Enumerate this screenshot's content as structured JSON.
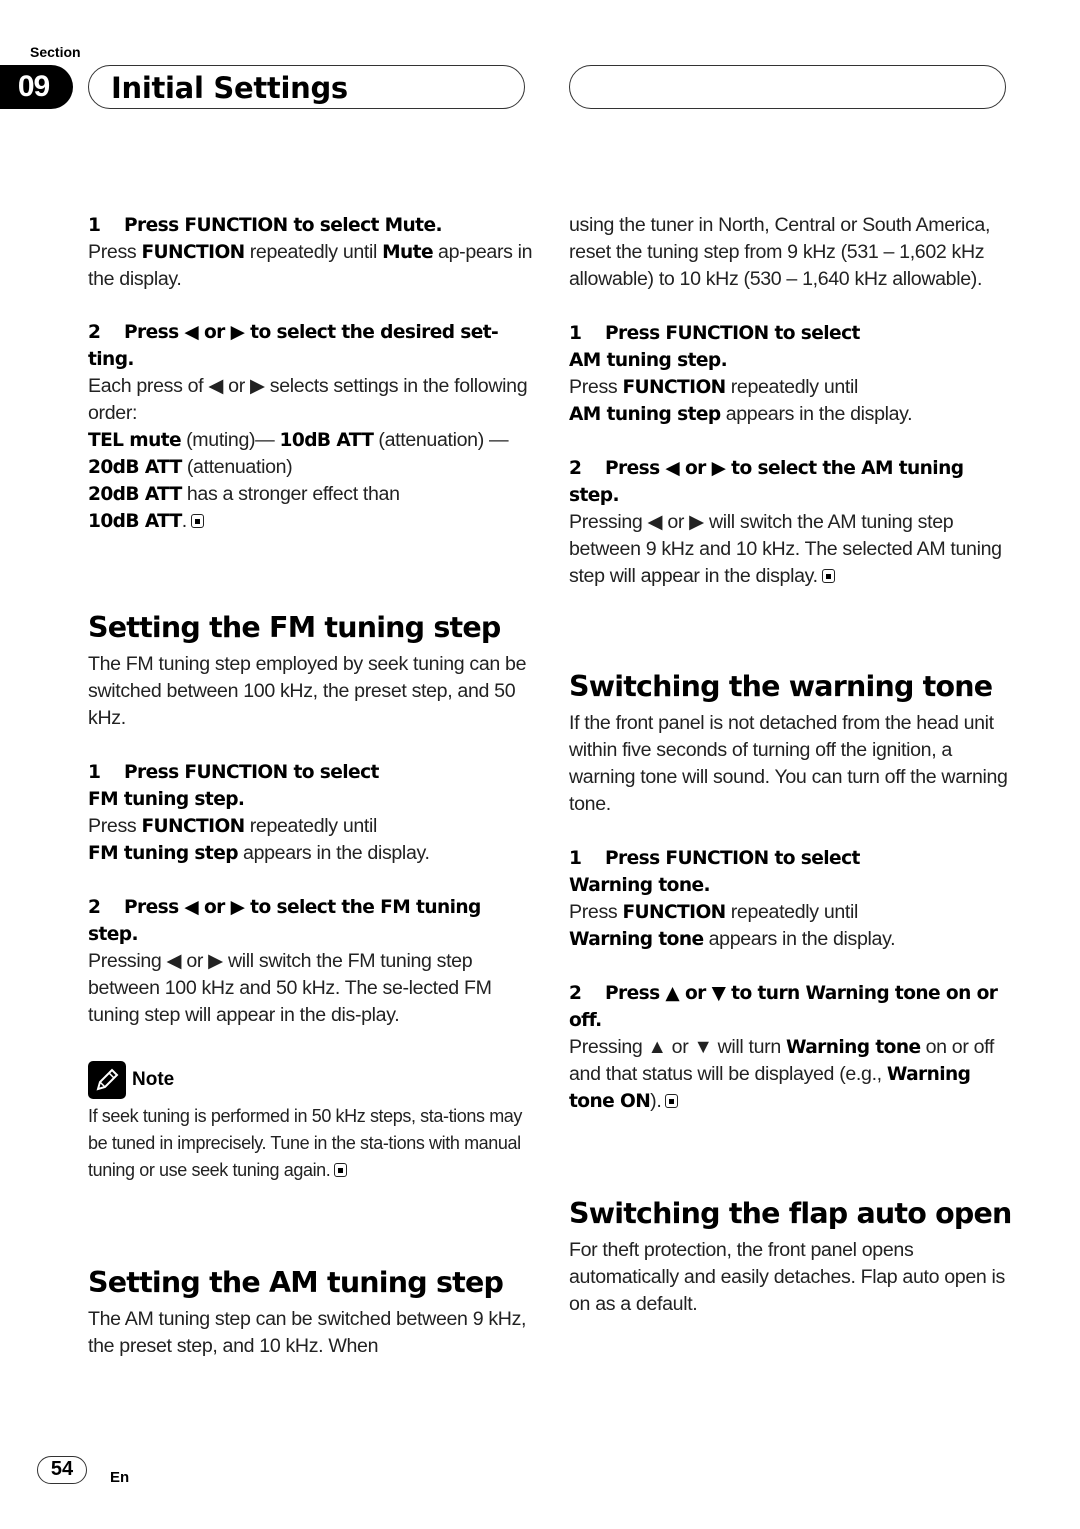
{
  "header": {
    "section_label": "Section",
    "section_number": "09",
    "title": "Initial Settings"
  },
  "left": {
    "mute_step1": {
      "num": "1",
      "heading": "Press FUNCTION to select Mute.",
      "body_pre": "Press ",
      "body_b1": "FUNCTION",
      "body_mid": " repeatedly until ",
      "body_b2": "Mute",
      "body_post": " ap-pears in the display."
    },
    "mute_step2": {
      "num": "2",
      "heading": "Press ◀ or ▶ to select the desired set-ting.",
      "body1": "Each press of ◀ or ▶ selects settings in the following order:",
      "order_b1": "TEL mute",
      "order_t1": " (muting)— ",
      "order_b2": "10dB ATT",
      "order_t2": " (attenuation) — ",
      "order_b3": "20dB ATT",
      "order_t3": " (attenuation)",
      "compare_b1": "20dB ATT",
      "compare_t": " has a stronger effect than ",
      "compare_b2": "10dB ATT",
      "compare_end": "."
    },
    "fm": {
      "title": "Setting the FM tuning step",
      "intro": "The FM tuning step employed by seek tuning can be switched between 100 kHz, the preset step, and 50 kHz.",
      "step1_num": "1",
      "step1_heading_a": "Press FUNCTION to select",
      "step1_heading_b": "FM tuning step.",
      "step1_pre": "Press ",
      "step1_b1": "FUNCTION",
      "step1_mid": " repeatedly until",
      "step1_b2": "FM tuning step",
      "step1_post": " appears in the display.",
      "step2_num": "2",
      "step2_heading": "Press ◀ or ▶ to select the FM tuning step.",
      "step2_body": "Pressing ◀ or ▶ will switch the FM tuning step between 100 kHz and 50 kHz. The se-lected FM tuning step will appear in the dis-play."
    },
    "note": {
      "label": "Note",
      "text": "If seek tuning is performed in 50 kHz steps, sta-tions may be tuned in imprecisely. Tune in the sta-tions with manual tuning or use seek tuning again."
    },
    "am": {
      "title": "Setting the AM tuning step",
      "intro": "The AM tuning step can be switched between 9 kHz, the preset step, and 10 kHz. When"
    }
  },
  "right": {
    "am_cont": "using the tuner in North, Central or South America, reset the tuning step from 9 kHz (531 – 1,602 kHz allowable) to 10 kHz (530 – 1,640 kHz allowable).",
    "am_step1_num": "1",
    "am_step1_heading_a": "Press FUNCTION to select",
    "am_step1_heading_b": "AM tuning step.",
    "am_step1_pre": "Press ",
    "am_step1_b1": "FUNCTION",
    "am_step1_mid": " repeatedly until",
    "am_step1_b2": "AM tuning step",
    "am_step1_post": " appears in the display.",
    "am_step2_num": "2",
    "am_step2_heading": "Press ◀ or ▶ to select the AM tuning step.",
    "am_step2_body": "Pressing ◀ or ▶ will switch the AM tuning step between 9 kHz and 10 kHz. The selected AM tuning step will appear in the display.",
    "warning": {
      "title": "Switching the warning tone",
      "intro": "If the front panel is not detached from the head unit within five seconds of turning off the ignition, a warning tone will sound. You can turn off the warning tone.",
      "step1_num": "1",
      "step1_heading_a": "Press FUNCTION to select",
      "step1_heading_b": "Warning tone.",
      "step1_pre": "Press ",
      "step1_b1": "FUNCTION",
      "step1_mid": " repeatedly until",
      "step1_b2": "Warning tone",
      "step1_post": " appears in the display.",
      "step2_num": "2",
      "step2_heading": "Press ▲ or ▼ to turn Warning tone on or off.",
      "step2_pre": "Pressing ▲ or ▼ will turn ",
      "step2_b1": "Warning tone",
      "step2_mid": " on or off and that status will be displayed (e.g., ",
      "step2_b2": "Warning tone ON",
      "step2_post": ")."
    },
    "flap": {
      "title": "Switching the flap auto open",
      "intro": "For theft protection, the front panel opens automatically and easily detaches. Flap auto open is on as a default."
    }
  },
  "footer": {
    "page_number": "54",
    "language": "En"
  }
}
